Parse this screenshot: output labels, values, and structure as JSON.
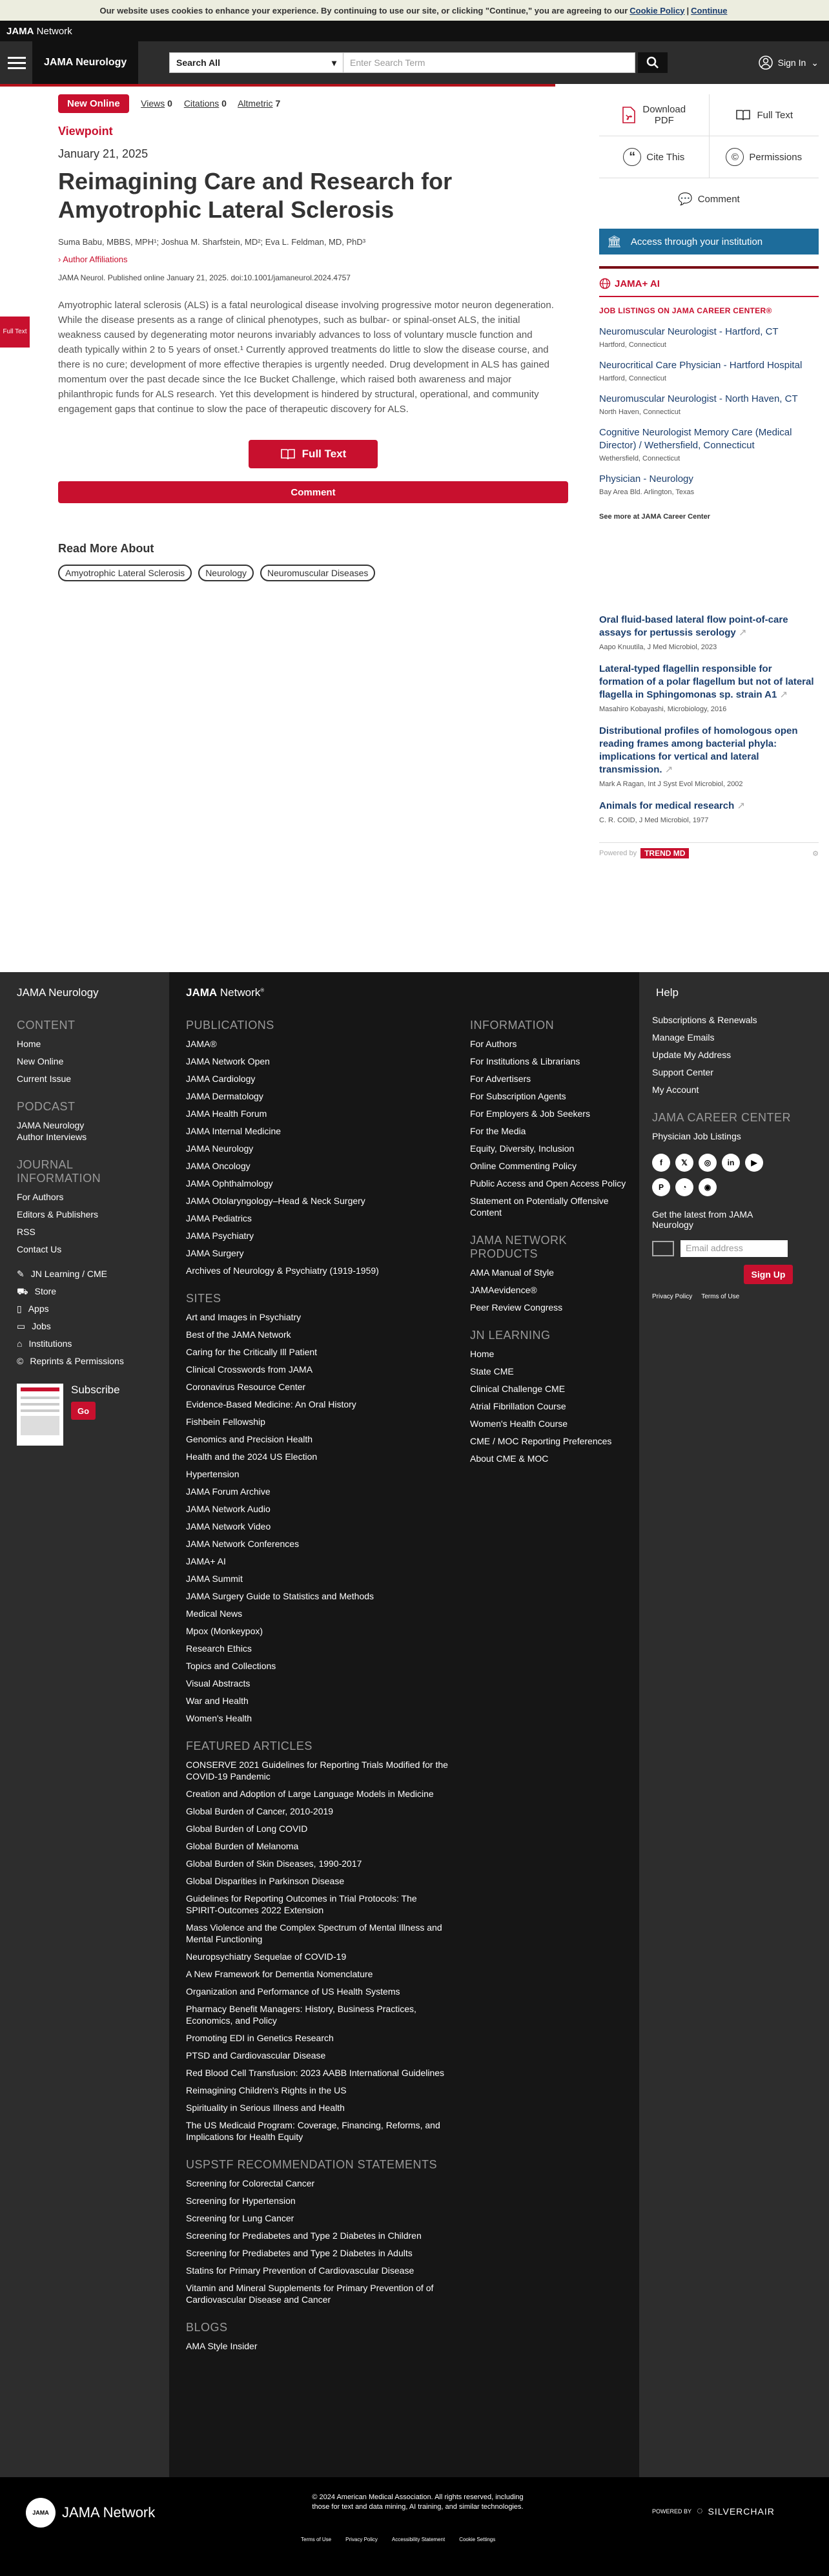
{
  "cookie": {
    "text": "Our website uses cookies to enhance your experience. By continuing to use our site, or clicking \"Continue,\" you are agreeing to our",
    "policy": "Cookie Policy",
    "sep": "|",
    "continue": "Continue"
  },
  "network": {
    "brand": "JAMA",
    "suffix": " Network"
  },
  "header": {
    "journal": "JAMA Neurology",
    "search_scope": "Search All",
    "search_placeholder": "Enter Search Term",
    "signin": "Sign In"
  },
  "article": {
    "badge": "New Online",
    "views_label": "Views",
    "views": "0",
    "citations_label": "Citations",
    "citations": "0",
    "altmetric_label": "Altmetric",
    "altmetric": "7",
    "type": "Viewpoint",
    "date": "January 21, 2025",
    "title": "Reimagining Care and Research for Amyotrophic Lateral Sclerosis",
    "authors": "Suma Babu, MBBS, MPH¹; Joshua M. Sharfstein, MD²; Eva L. Feldman, MD, PhD³",
    "affiliations": "Author Affiliations",
    "citation": "JAMA Neurol. Published online January 21, 2025. doi:10.1001/jamaneurol.2024.4757",
    "abstract": "Amyotrophic lateral sclerosis (ALS) is a fatal neurological disease involving progressive motor neuron degeneration. While the disease presents as a range of clinical phenotypes, such as bulbar- or spinal-onset ALS, the initial weakness caused by degenerating motor neurons invariably advances to loss of voluntary muscle function and death typically within 2 to 5 years of onset.¹ Currently approved treatments do little to slow the disease course, and there is no cure; development of more effective therapies is urgently needed. Drug development in ALS has gained momentum over the past decade since the Ice Bucket Challenge, which raised both awareness and major philanthropic funds for ALS research. Yet this development is hindered by structural, operational, and community engagement gaps that continue to slow the pace of therapeutic discovery for ALS.",
    "full_text": "Full Text",
    "comment": "Comment",
    "read_more": "Read More About",
    "tags": [
      "Amyotrophic Lateral Sclerosis",
      "Neurology",
      "Neuromuscular Diseases"
    ],
    "side_tab": "Full Text"
  },
  "tools": {
    "download": "Download PDF",
    "full_text": "Full Text",
    "cite": "Cite This",
    "permissions": "Permissions",
    "comment": "Comment",
    "access": "Access through your institution",
    "jama_ai": "JAMA+ AI"
  },
  "jobs": {
    "heading": "JOB LISTINGS ON JAMA CAREER CENTER®",
    "items": [
      {
        "title": "Neuromuscular Neurologist - Hartford, CT",
        "loc": "Hartford, Connecticut"
      },
      {
        "title": "Neurocritical Care Physician - Hartford Hospital",
        "loc": "Hartford, Connecticut"
      },
      {
        "title": "Neuromuscular Neurologist - North Haven, CT",
        "loc": "North Haven, Connecticut"
      },
      {
        "title": "Cognitive Neurologist Memory Care (Medical Director) / Wethersfield, Connecticut",
        "loc": "Wethersfield, Connecticut"
      },
      {
        "title": "Physician - Neurology",
        "loc": "Bay Area Bld. Arlington, Texas"
      }
    ],
    "see_more": "See more at JAMA Career Center"
  },
  "trending": {
    "items": [
      {
        "title": "Oral fluid-based lateral flow point-of-care assays for pertussis serology",
        "meta": "Aapo Knuutila, J Med Microbiol, 2023"
      },
      {
        "title": "Lateral-typed flagellin responsible for formation of a polar flagellum but not of lateral flagella in Sphingomonas sp. strain A1",
        "meta": "Masahiro Kobayashi, Microbiology, 2016"
      },
      {
        "title": "Distributional profiles of homologous open reading frames among bacterial phyla: implications for vertical and lateral transmission.",
        "meta": "Mark A Ragan, Int J Syst Evol Microbiol, 2002"
      },
      {
        "title": "Animals for medical research",
        "meta": "C. R. COID, J Med Microbiol, 1977"
      }
    ],
    "powered": "Powered by",
    "trendmd": "TREND MD"
  },
  "footer": {
    "journal": "JAMA Neurology",
    "network": "JAMA Network",
    "help": "Help",
    "content_h": "CONTENT",
    "content": [
      "Home",
      "New Online",
      "Current Issue"
    ],
    "podcast_h": "PODCAST",
    "podcast": [
      "JAMA Neurology Author Interviews"
    ],
    "journal_info_h": "JOURNAL INFORMATION",
    "journal_info": [
      "For Authors",
      "Editors & Publishers",
      "RSS",
      "Contact Us"
    ],
    "services": [
      "JN Learning / CME",
      "Store",
      "Apps",
      "Jobs",
      "Institutions",
      "Reprints & Permissions"
    ],
    "subscribe": "Subscribe",
    "go": "Go",
    "publications_h": "PUBLICATIONS",
    "publications": [
      "JAMA®",
      "JAMA Network Open",
      "JAMA Cardiology",
      "JAMA Dermatology",
      "JAMA Health Forum",
      "JAMA Internal Medicine",
      "JAMA Neurology",
      "JAMA Oncology",
      "JAMA Ophthalmology",
      "JAMA Otolaryngology–Head & Neck Surgery",
      "JAMA Pediatrics",
      "JAMA Psychiatry",
      "JAMA Surgery",
      "Archives of Neurology & Psychiatry (1919-1959)"
    ],
    "sites_h": "SITES",
    "sites": [
      "Art and Images in Psychiatry",
      "Best of the JAMA Network",
      "Caring for the Critically Ill Patient",
      "Clinical Crosswords from JAMA",
      "Coronavirus Resource Center",
      "Evidence-Based Medicine: An Oral History",
      "Fishbein Fellowship",
      "Genomics and Precision Health",
      "Health and the 2024 US Election",
      "Hypertension",
      "JAMA Forum Archive",
      "JAMA Network Audio",
      "JAMA Network Video",
      "JAMA Network Conferences",
      "JAMA+ AI",
      "JAMA Summit",
      "JAMA Surgery Guide to Statistics and Methods",
      "Medical News",
      "Mpox (Monkeypox)",
      "Research Ethics",
      "Topics and Collections",
      "Visual Abstracts",
      "War and Health",
      "Women's Health"
    ],
    "featured_h": "FEATURED ARTICLES",
    "featured": [
      "CONSERVE 2021 Guidelines for Reporting Trials Modified for the COVID-19 Pandemic",
      "Creation and Adoption of Large Language Models in Medicine",
      "Global Burden of Cancer, 2010-2019",
      "Global Burden of Long COVID",
      "Global Burden of Melanoma",
      "Global Burden of Skin Diseases, 1990-2017",
      "Global Disparities in Parkinson Disease",
      "Guidelines for Reporting Outcomes in Trial Protocols: The SPIRIT-Outcomes 2022 Extension",
      "Mass Violence and the Complex Spectrum of Mental Illness and Mental Functioning",
      "Neuropsychiatry Sequelae of COVID-19",
      "A New Framework for Dementia Nomenclature",
      "Organization and Performance of US Health Systems",
      "Pharmacy Benefit Managers: History, Business Practices, Economics, and Policy",
      "Promoting EDI in Genetics Research",
      "PTSD and Cardiovascular Disease",
      "Red Blood Cell Transfusion: 2023 AABB International Guidelines",
      "Reimagining Children's Rights in the US",
      "Spirituality in Serious Illness and Health",
      "The US Medicaid Program: Coverage, Financing, Reforms, and Implications for Health Equity"
    ],
    "uspstf_h": "USPSTF RECOMMENDATION STATEMENTS",
    "uspstf": [
      "Screening for Colorectal Cancer",
      "Screening for Hypertension",
      "Screening for Lung Cancer",
      "Screening for Prediabetes and Type 2 Diabetes in Children",
      "Screening for Prediabetes and Type 2 Diabetes in Adults",
      "Statins for Primary Prevention of Cardiovascular Disease",
      "Vitamin and Mineral Supplements for Primary Prevention of of Cardiovascular Disease and Cancer"
    ],
    "blogs_h": "BLOGS",
    "blogs": [
      "AMA Style Insider"
    ],
    "information_h": "INFORMATION",
    "information": [
      "For Authors",
      "For Institutions & Librarians",
      "For Advertisers",
      "For Subscription Agents",
      "For Employers & Job Seekers",
      "For the Media",
      "Equity, Diversity, Inclusion",
      "Online Commenting Policy",
      "Public Access and Open Access Policy",
      "Statement on Potentially Offensive Content"
    ],
    "products_h": "JAMA NETWORK PRODUCTS",
    "products": [
      "AMA Manual of Style",
      "JAMAevidence®",
      "Peer Review Congress"
    ],
    "learning_h": "JN LEARNING",
    "learning": [
      "Home",
      "State CME",
      "Clinical Challenge CME",
      "Atrial Fibrillation Course",
      "Women's Health Course",
      "CME / MOC Reporting Preferences",
      "About CME & MOC"
    ],
    "help_links": [
      "Subscriptions & Renewals",
      "Manage Emails",
      "Update My Address",
      "Support Center",
      "My Account"
    ],
    "career_h": "JAMA CAREER CENTER",
    "career": [
      "Physician Job Listings"
    ],
    "latest": "Get the latest from JAMA Neurology",
    "email_placeholder": "Email address",
    "signup": "Sign Up",
    "privacy": "Privacy Policy",
    "terms": "Terms of Use",
    "copyright": "© 2024 American Medical Association. All rights reserved, including those for text and data mining, AI training, and similar technologies.",
    "bottom_links": [
      "Terms of Use",
      "Privacy Policy",
      "Accessibility Statement",
      "Cookie Settings"
    ],
    "powered_by": "POWERED BY",
    "silverchair": "SILVERCHAIR",
    "logo_text": "JAMA Network"
  }
}
